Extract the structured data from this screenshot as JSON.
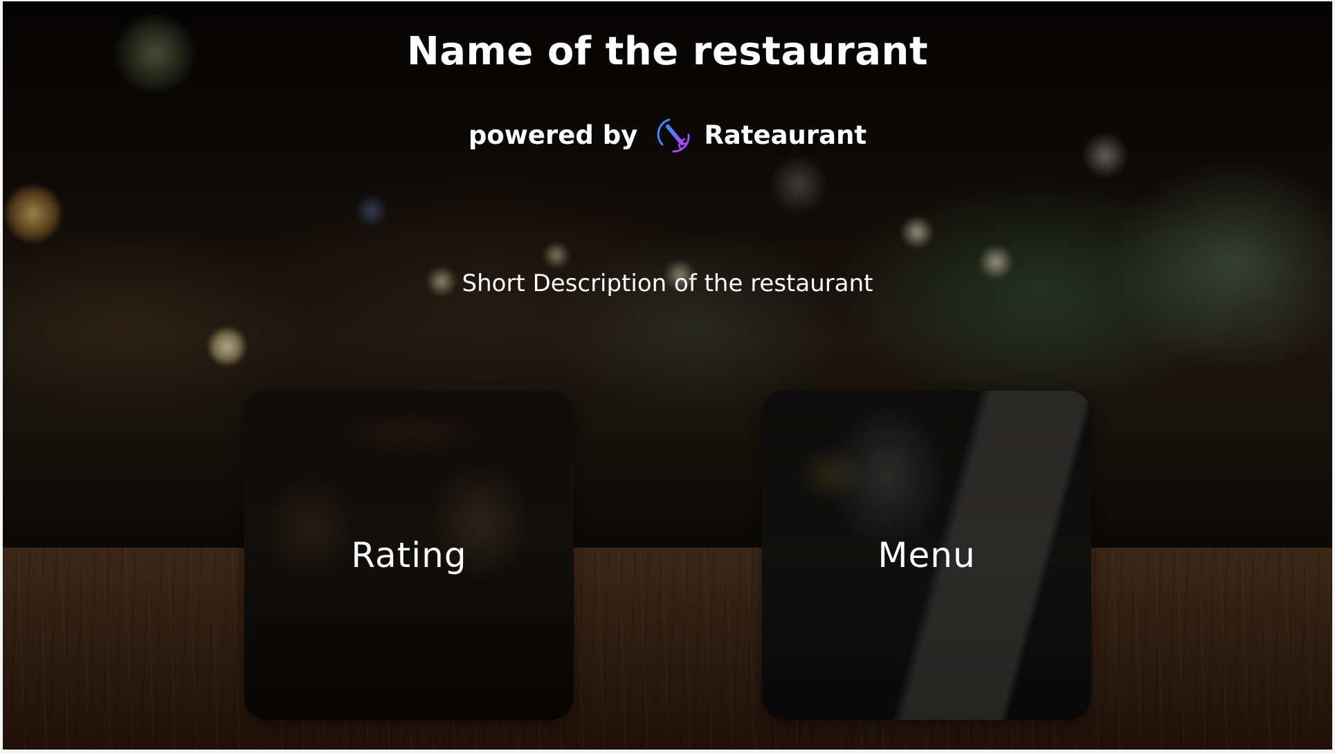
{
  "header": {
    "title": "Name of the restaurant",
    "powered_by": "powered by",
    "brand_name": "Rateaurant",
    "brand_colors": [
      "#3b8cff",
      "#a24dff"
    ]
  },
  "description": "Short Description of the restaurant",
  "cards": [
    {
      "label": "Rating",
      "icon": "rating-card"
    },
    {
      "label": "Menu",
      "icon": "menu-card"
    }
  ],
  "theme": {
    "text_color": "#ffffff",
    "background": "dark blurred restaurant interior",
    "card_overlay": "rgba(0,0,0,0.52)"
  }
}
